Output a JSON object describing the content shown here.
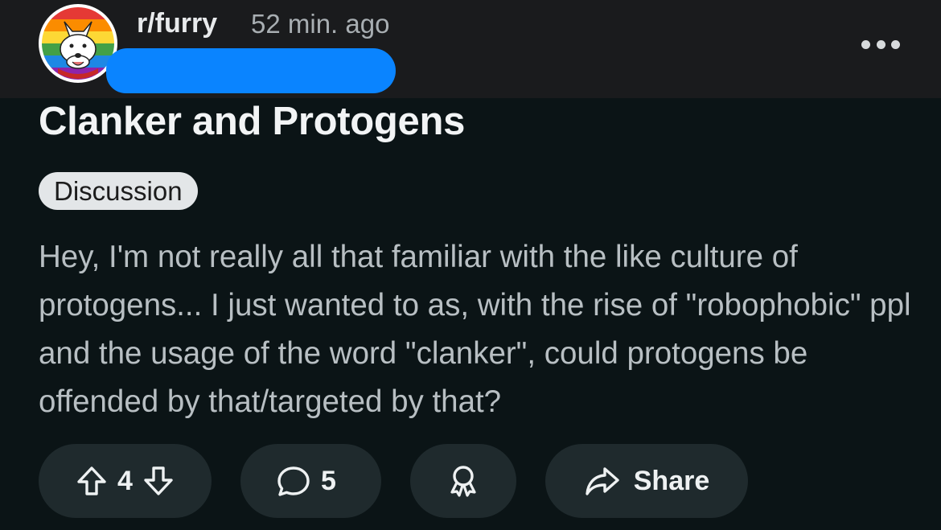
{
  "post": {
    "subreddit": "r/furry",
    "time_ago": "52 min. ago",
    "title": "Clanker and Protogens",
    "flair": "Discussion",
    "body": "Hey, I'm not really all that familiar with the like culture of protogens... I just wanted to as, with the rise of \"robophobic\" ppl and the usage of the word \"clanker\", could protogens be offended by that/targeted by that?"
  },
  "actions": {
    "vote_count": "4",
    "comment_count": "5",
    "share_label": "Share"
  },
  "icons": {
    "more": "more-options-icon",
    "upvote": "upvote-icon",
    "downvote": "downvote-icon",
    "comment": "comment-icon",
    "award": "award-icon",
    "share": "share-arrow-icon"
  },
  "colors": {
    "background": "#0b1416",
    "header": "#1a1b1d",
    "button": "#1f2a2d",
    "redaction": "#0a84ff",
    "flair": "#e3e6e8"
  }
}
